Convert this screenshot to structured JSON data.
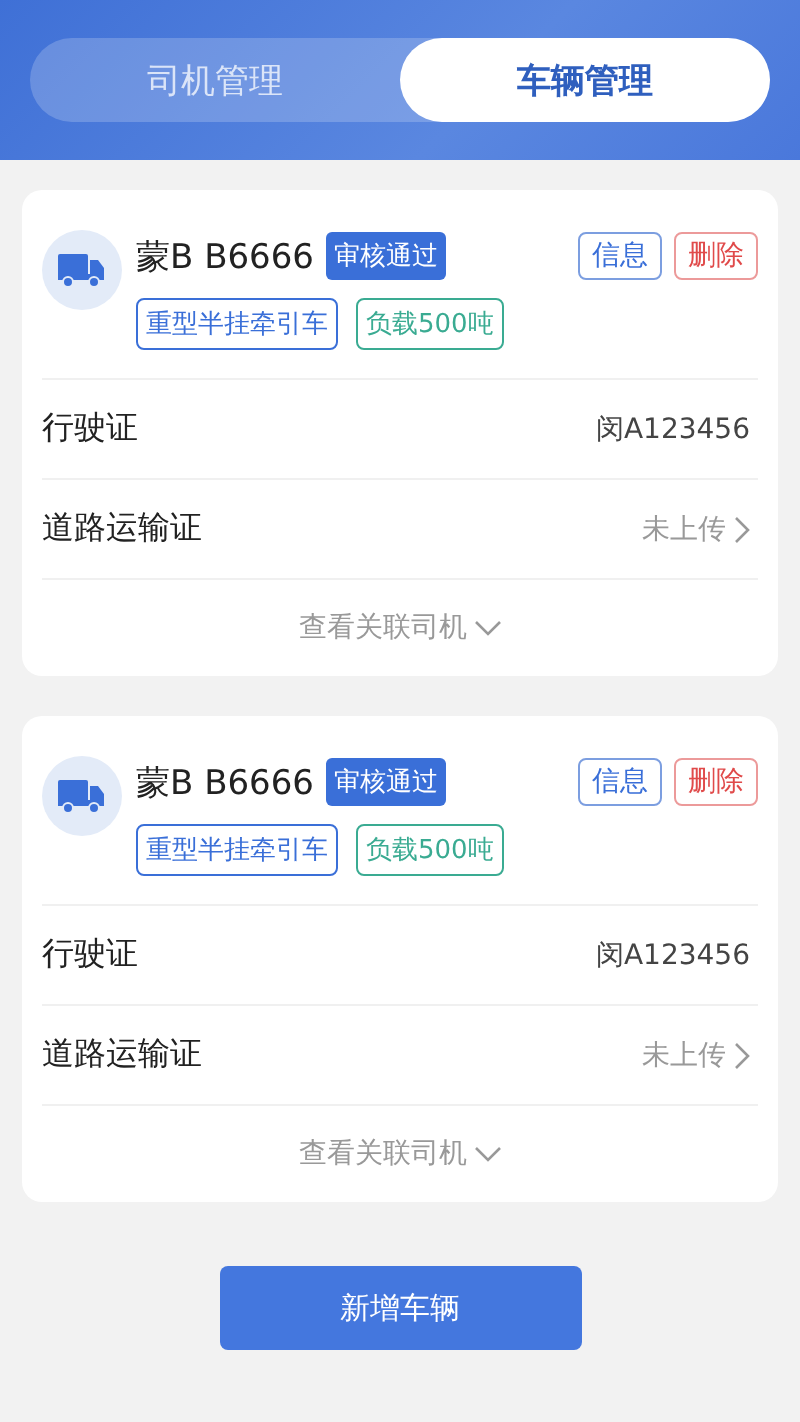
{
  "tabs": [
    {
      "label": "司机管理",
      "selected": false
    },
    {
      "label": "车辆管理",
      "selected": true
    }
  ],
  "vehicles": [
    {
      "plate": "蒙B B6666",
      "status": "审核通过",
      "actions": [
        {
          "label": "信息",
          "kind": "primary"
        },
        {
          "label": "删除",
          "kind": "danger"
        }
      ],
      "tags": [
        {
          "label": "重型半挂牵引车",
          "color": "#3a6fd8"
        },
        {
          "label": "负载500吨",
          "color": "#3aab92"
        }
      ],
      "rows": [
        {
          "label": "行驶证",
          "value": "闵A123456",
          "kind": "value"
        },
        {
          "label": "道路运输证",
          "value": "未上传",
          "kind": "link"
        }
      ],
      "footer": "查看关联司机"
    },
    {
      "plate": "蒙B B6666",
      "status": "审核通过",
      "actions": [
        {
          "label": "信息",
          "kind": "primary"
        },
        {
          "label": "删除",
          "kind": "danger"
        }
      ],
      "tags": [
        {
          "label": "重型半挂牵引车",
          "color": "#3a6fd8"
        },
        {
          "label": "负载500吨",
          "color": "#3aab92"
        }
      ],
      "rows": [
        {
          "label": "行驶证",
          "value": "闵A123456",
          "kind": "value"
        },
        {
          "label": "道路运输证",
          "value": "未上传",
          "kind": "link"
        }
      ],
      "footer": "查看关联司机"
    }
  ],
  "add_button": "新增车辆"
}
